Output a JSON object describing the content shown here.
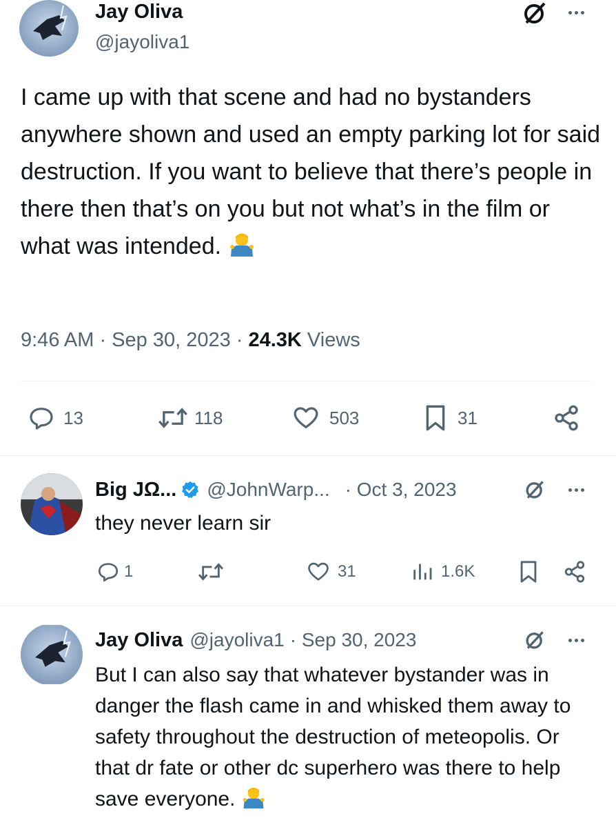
{
  "main_tweet": {
    "author_name": "Jay Oliva",
    "author_handle": "@jayoliva1",
    "text": "I came up with that scene and had no bystanders anywhere shown and used an empty parking lot for said destruction. If you want to believe that there’s people in there then that’s on you but not what’s in the film or what was intended.",
    "time": "9:46 AM · Sep 30, 2023 · ",
    "views_count": "24.3K",
    "views_label": " Views",
    "replies": "13",
    "retweets": "118",
    "likes": "503",
    "bookmarks": "31"
  },
  "reply_1": {
    "author_name": "Big JΩ...",
    "author_handle": "@JohnWarp...",
    "date": "· Oct 3, 2023",
    "text": "they never learn sir",
    "replies": "1",
    "retweets": "",
    "likes": "31",
    "views": "1.6K"
  },
  "reply_2": {
    "author_name": "Jay Oliva",
    "author_handle": "@jayoliva1",
    "date": "· Sep 30, 2023",
    "text": "But I can also say that whatever bystander was in danger the flash came in and whisked them away to safety throughout the destruction of meteopolis. Or that dr fate or other dc superhero was there to help save everyone."
  },
  "colors": {
    "text_primary": "#0f1419",
    "text_secondary": "#536471",
    "verified_blue": "#1d9bf0",
    "divider": "#eff3f4"
  },
  "icons": [
    "grok-icon",
    "more-icon",
    "reply-icon",
    "retweet-icon",
    "like-icon",
    "bookmark-icon",
    "share-icon",
    "views-icon",
    "verified-badge-icon",
    "person-shrugging-emoji"
  ]
}
